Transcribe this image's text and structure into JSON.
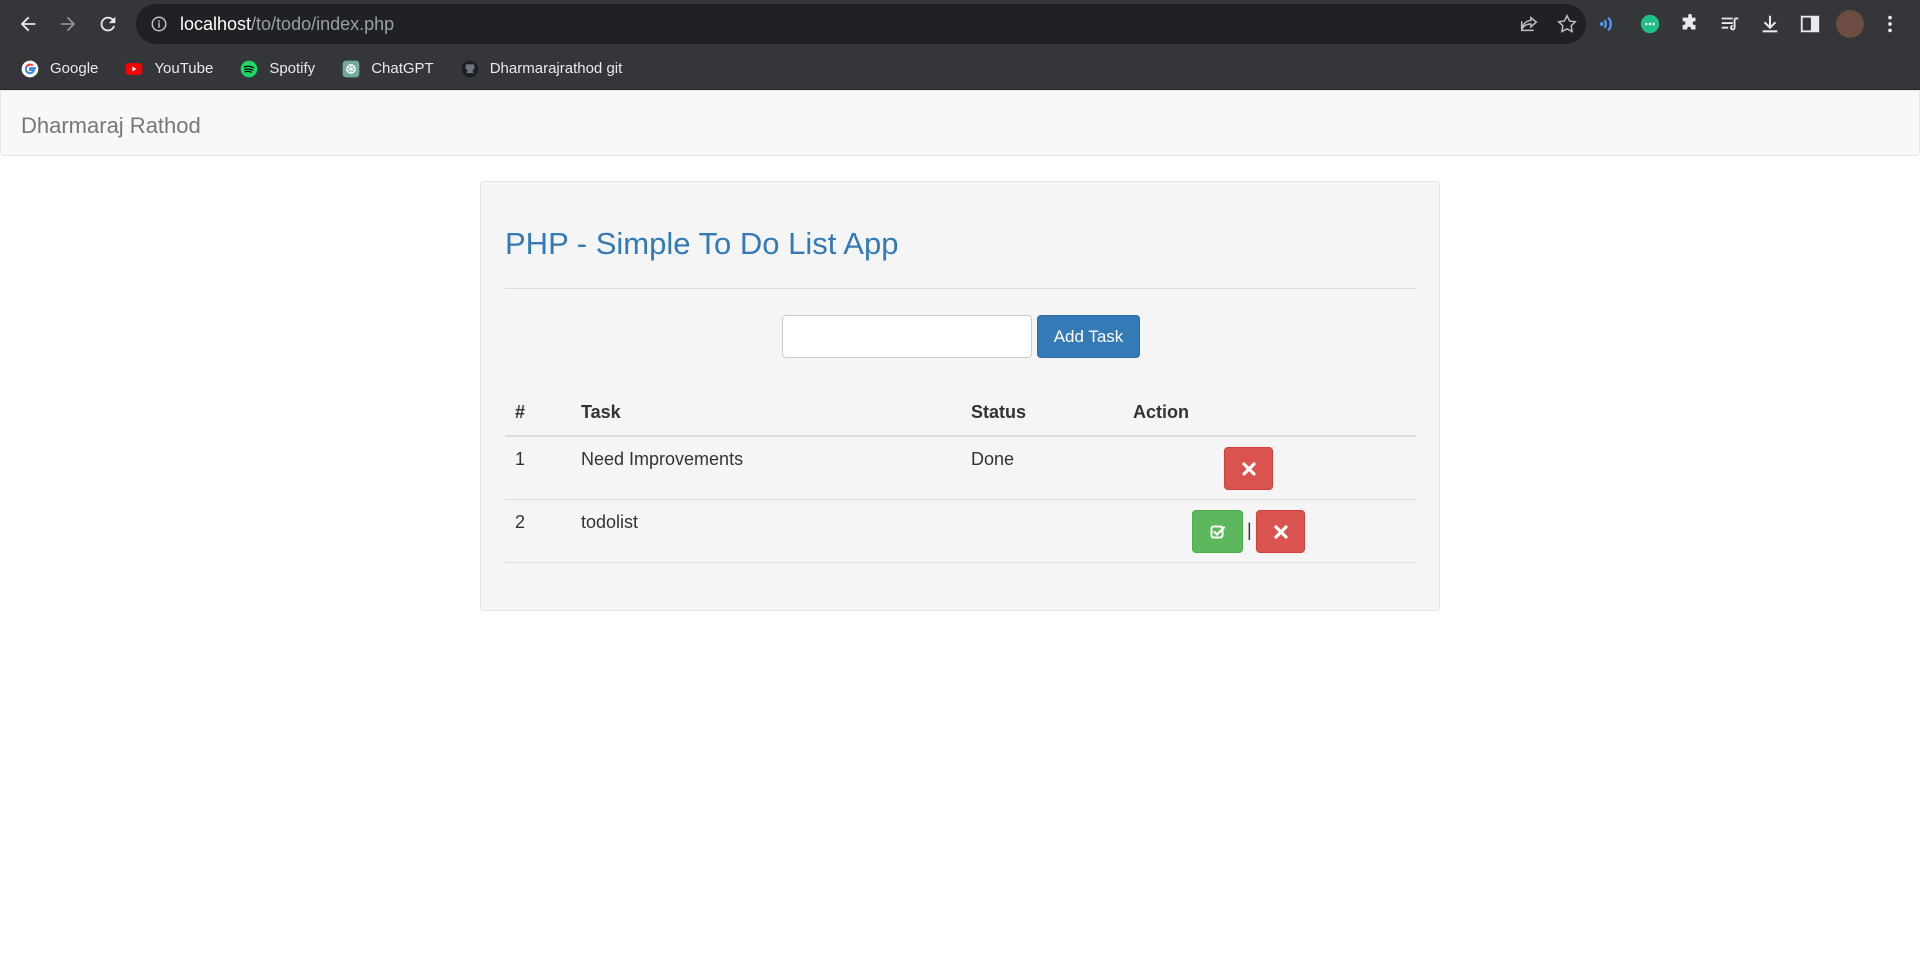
{
  "browser": {
    "url_host": "localhost",
    "url_path": "/to/todo/index.php",
    "bookmarks": [
      {
        "label": "Google",
        "icon": "google-icon"
      },
      {
        "label": "YouTube",
        "icon": "youtube-icon"
      },
      {
        "label": "Spotify",
        "icon": "spotify-icon"
      },
      {
        "label": "ChatGPT",
        "icon": "chatgpt-icon"
      },
      {
        "label": "Dharmarajrathod git",
        "icon": "github-icon"
      }
    ]
  },
  "navbar": {
    "brand": "Dharmaraj Rathod"
  },
  "app": {
    "title": "PHP - Simple To Do List App",
    "task_input_value": "",
    "add_button_label": "Add Task"
  },
  "table": {
    "headers": [
      "#",
      "Task",
      "Status",
      "Action"
    ],
    "rows": [
      {
        "num": "1",
        "task": "Need Improvements",
        "status": "Done",
        "actions": [
          "delete"
        ]
      },
      {
        "num": "2",
        "task": "todolist",
        "status": "",
        "actions": [
          "complete",
          "delete"
        ],
        "separator": "|"
      }
    ]
  },
  "colors": {
    "primary": "#337ab7",
    "danger": "#d9534f",
    "success": "#5cb85c",
    "navbar_bg": "#f8f8f8",
    "well_bg": "#f5f5f5"
  }
}
